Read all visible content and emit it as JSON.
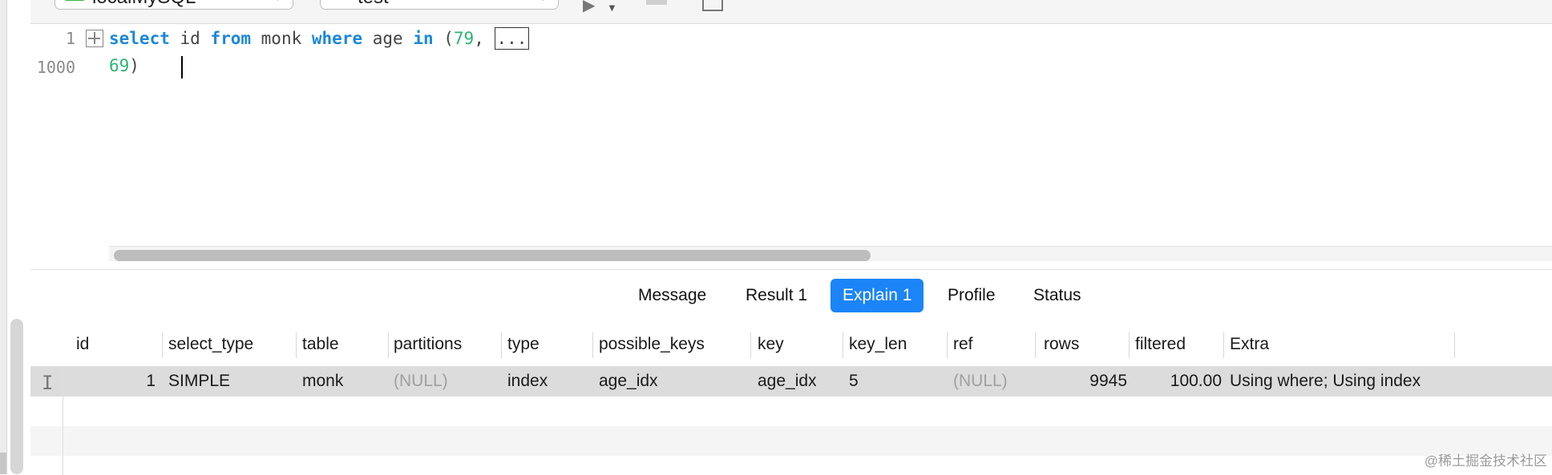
{
  "toolbar": {
    "connection": "localMySQL",
    "database": "test"
  },
  "editor": {
    "line_numbers": [
      "1",
      "1000"
    ],
    "line1": {
      "kw1": "select",
      "t1": " id ",
      "kw2": "from",
      "t2": " monk ",
      "kw3": "where",
      "t3": " age ",
      "kw4": "in",
      "t4": " (",
      "n1": "79",
      "t5": ", ",
      "folded": "..."
    },
    "line2": {
      "n2": "69",
      "t6": ")"
    }
  },
  "tabs": [
    {
      "label": "Message"
    },
    {
      "label": "Result 1"
    },
    {
      "label": "Explain 1",
      "active": true
    },
    {
      "label": "Profile"
    },
    {
      "label": "Status"
    }
  ],
  "table": {
    "columns": [
      "id",
      "select_type",
      "table",
      "partitions",
      "type",
      "possible_keys",
      "key",
      "key_len",
      "ref",
      "rows",
      "filtered",
      "Extra"
    ],
    "rows": [
      [
        "1",
        "SIMPLE",
        "monk",
        "(NULL)",
        "index",
        "age_idx",
        "age_idx",
        "5",
        "(NULL)",
        "9945",
        "100.00",
        "Using where; Using index"
      ]
    ]
  },
  "watermark": "@稀土掘金技术社区",
  "colors": {
    "accent": "#1b84f7",
    "keyword": "#1c88d9",
    "number": "#2bb673"
  }
}
